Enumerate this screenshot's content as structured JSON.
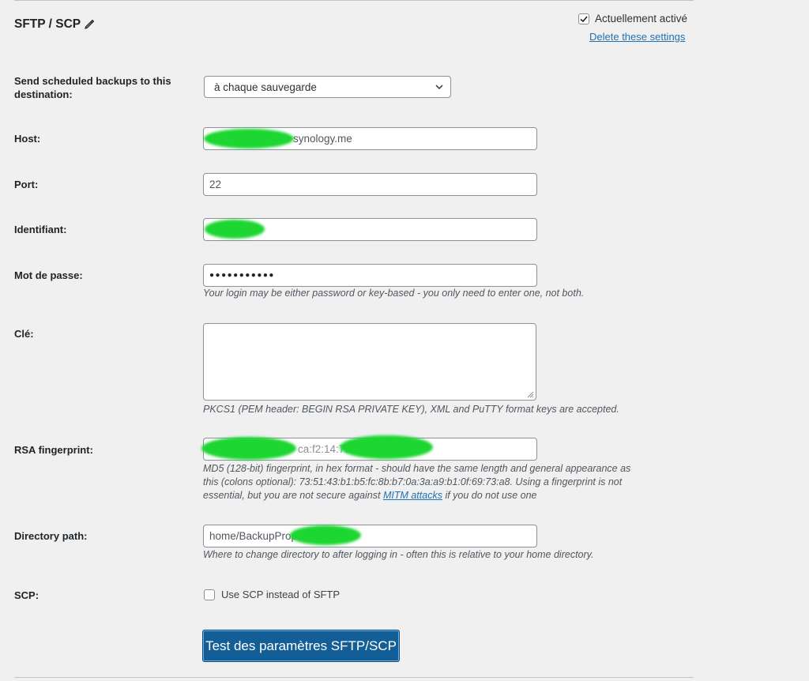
{
  "header": {
    "title": "SFTP / SCP",
    "active_label": "Actuellement activé",
    "active_checked": true,
    "delete_link": "Delete these settings"
  },
  "fields": {
    "schedule_label": "Send scheduled backups to this destination:",
    "schedule_value": "à chaque sauvegarde",
    "host_label": "Host:",
    "host_value": "synology.me",
    "port_label": "Port:",
    "port_value": "22",
    "login_label": "Identifiant:",
    "login_value": "",
    "password_label": "Mot de passe:",
    "password_value": "●●●●●●●●●●●",
    "password_help": "Your login may be either password or key-based - you only need to enter one, not both.",
    "key_label": "Clé:",
    "key_help": "PKCS1 (PEM header: BEGIN RSA PRIVATE KEY), XML and PuTTY format keys are accepted.",
    "fingerprint_label": "RSA fingerprint:",
    "fingerprint_value": "ca:f2:14:79",
    "fingerprint_help_1": "MD5 (128-bit) fingerprint, in hex format - should have the same length and general appearance as",
    "fingerprint_help_2": "this (colons optional): 73:51:43:b1:b5:fc:8b:b7:0a:3a:a9:b1:0f:69:73:a8. Using a fingerprint is not",
    "fingerprint_help_3a": "essential, but you are not secure against",
    "fingerprint_help_link": "MITM attacks",
    "fingerprint_help_3b": "if you do not use one",
    "dir_label": "Directory path:",
    "dir_value": "home/BackupProp",
    "dir_help": "Where to change directory to after logging in - often this is relative to your home directory.",
    "scp_label": "SCP:",
    "scp_option": "Use SCP instead of SFTP",
    "scp_checked": false
  },
  "actions": {
    "test_button": "Test des paramètres SFTP/SCP"
  },
  "colors": {
    "primary": "#135e96",
    "link": "#2271b1",
    "redaction": "#1dd632",
    "background": "#f0f0f1"
  }
}
